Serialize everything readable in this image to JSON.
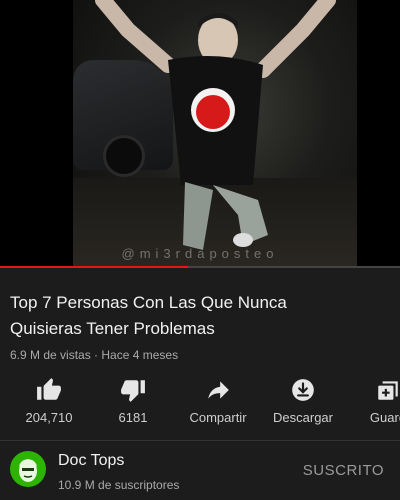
{
  "video": {
    "watermark": "@mi3rdaposteo",
    "progress_fraction": 0.47,
    "progress_color": "#e8131b"
  },
  "info": {
    "title_line1": "Top 7 Personas Con Las Que Nunca",
    "title_line2": "Quisieras Tener Problemas",
    "meta": "6.9 M de vistas · Hace 4 meses"
  },
  "actions": [
    {
      "icon": "thumbs-up-icon",
      "label": "204,710"
    },
    {
      "icon": "thumbs-down-icon",
      "label": "6181"
    },
    {
      "icon": "share-icon",
      "label": "Compartir"
    },
    {
      "icon": "download-icon",
      "label": "Descargar"
    },
    {
      "icon": "save-to-playlist-icon",
      "label": "Guard"
    }
  ],
  "channel": {
    "name": "Doc Tops",
    "subscribers": "10.9 M de suscriptores",
    "subscribed_label": "SUSCRITO",
    "avatar_color": "#2db400"
  }
}
